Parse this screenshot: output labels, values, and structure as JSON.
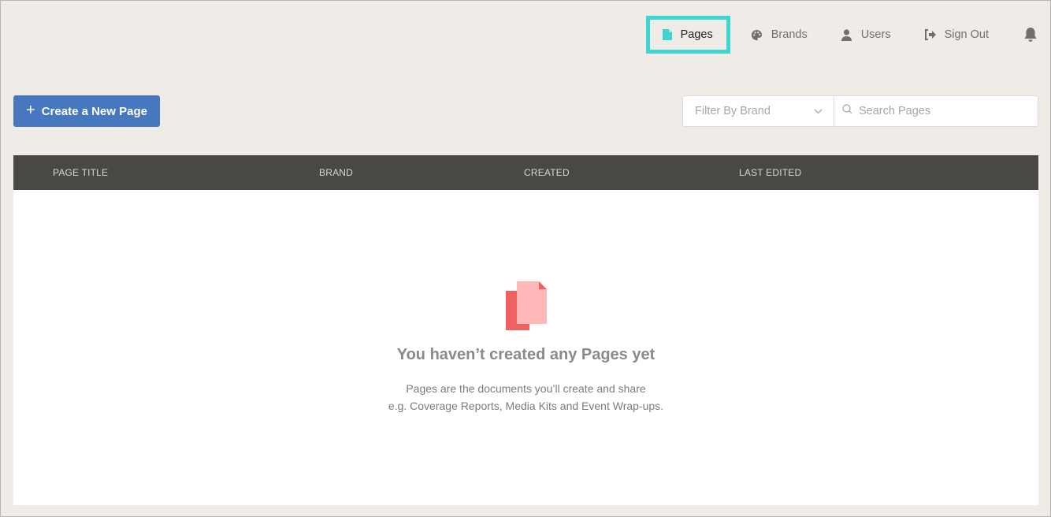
{
  "nav": {
    "items": [
      {
        "label": "Pages",
        "icon": "file-icon",
        "active": true
      },
      {
        "label": "Brands",
        "icon": "palette-icon"
      },
      {
        "label": "Users",
        "icon": "user-icon"
      },
      {
        "label": "Sign Out",
        "icon": "sign-out-icon"
      }
    ],
    "notifications_icon": "bell-icon"
  },
  "toolbar": {
    "create_label": "Create a New Page",
    "filter_placeholder": "Filter By Brand",
    "search_placeholder": "Search Pages"
  },
  "table": {
    "columns": [
      "PAGE TITLE",
      "BRAND",
      "CREATED",
      "LAST EDITED"
    ]
  },
  "empty_state": {
    "title": "You haven’t created any Pages yet",
    "line1": "Pages are the documents you’ll create and share",
    "line2": "e.g. Coverage Reports, Media Kits and Event Wrap-ups."
  },
  "colors": {
    "accent": "#4778bf",
    "highlight": "#3fd4d0",
    "header_bg": "#4a4844",
    "empty_icon_dark": "#f06262",
    "empty_icon_light": "#ffb8b8"
  }
}
